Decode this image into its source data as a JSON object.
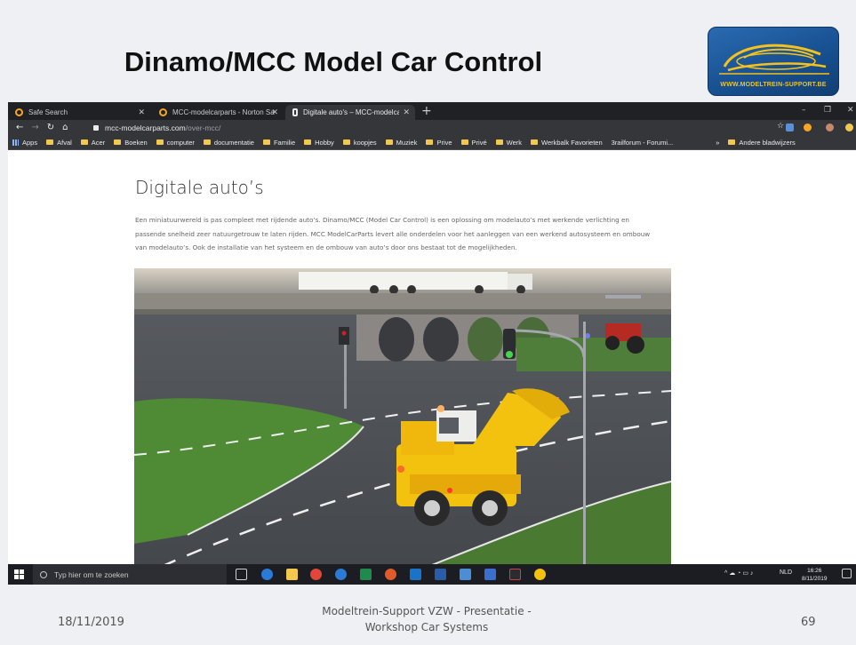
{
  "slide": {
    "title": "Dinamo/MCC Model Car Control",
    "logo_url_text": "WWW.MODELTREIN-SUPPORT.BE",
    "footer": {
      "date": "18/11/2019",
      "center_line1": "Modeltrein-Support  VZW - Presentatie -",
      "center_line2": "Workshop  Car Systems",
      "page_number": "69"
    }
  },
  "browser": {
    "tabs": [
      {
        "label": "Safe Search"
      },
      {
        "label": "MCC-modelcarparts - Norton Sa"
      },
      {
        "label": "Digitale auto's – MCC-modelcarp"
      }
    ],
    "new_tab": "+",
    "address": {
      "domain": "mcc-modelcarparts.com",
      "path": "/over-mcc/"
    },
    "bookmarks": [
      "Apps",
      "Afval",
      "Acer",
      "Boeken",
      "computer",
      "documentatie",
      "Familie",
      "Hobby",
      "koopjes",
      "Muziek",
      "Prive",
      "Privé",
      "Werk",
      "Werkbalk Favorieten",
      "3railforum - Forumi...",
      "»",
      "Andere bladwijzers"
    ]
  },
  "page": {
    "heading": "Digitale auto’s",
    "paragraph_lines": [
      "Een miniatuurwereld is pas compleet met rijdende auto’s. Dinamo/MCC (Model Car Control) is een oplossing om modelauto’s met werkende verlichting en",
      "passende snelheid zeer natuurgetrouw te laten rijden. MCC ModelCarParts levert alle onderdelen voor het aanleggen van een werkend autosysteem en ombouw",
      "van modelauto’s. Ook de installatie van het systeem en de ombouw van auto’s door ons bestaat tot de mogelijkheden."
    ]
  },
  "taskbar": {
    "search_placeholder": "Typ hier om te zoeken",
    "language": "NLD",
    "time": "16:26",
    "date": "8/11/2019"
  },
  "colors": {
    "browser_dark": "#202124",
    "toolbar": "#35363a",
    "taskbar": "#1c1d22",
    "logo_blue": "#1b5aa0",
    "logo_gold": "#f4c21a"
  }
}
